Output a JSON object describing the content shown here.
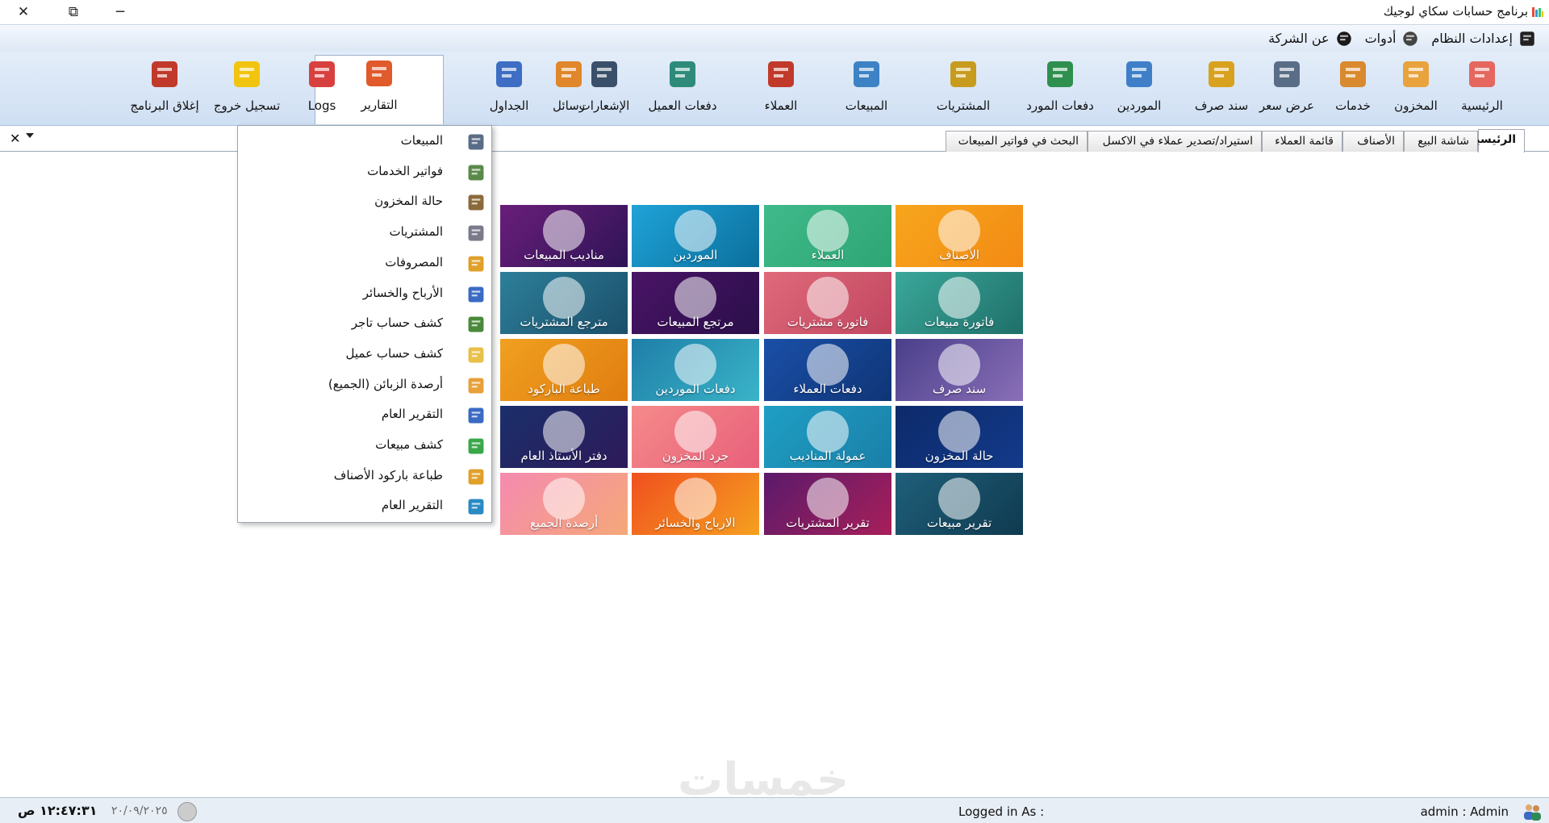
{
  "window": {
    "title": "برنامج حسابات سكاي لوجيك",
    "close_glyph": "✕",
    "restore_glyph": "⧉",
    "minimize_glyph": "─"
  },
  "menubar": {
    "items": [
      {
        "label": "إعدادات النظام",
        "icon": "wallet-icon"
      },
      {
        "label": "أدوات",
        "icon": "gear-icon"
      },
      {
        "label": "عن الشركة",
        "icon": "info-icon"
      }
    ]
  },
  "toolbar": {
    "buttons": [
      {
        "label": "الرئيسية",
        "icon": "home-icon",
        "color": "#e5675e"
      },
      {
        "label": "المخزون",
        "icon": "inventory-icon",
        "color": "#e8a33d"
      },
      {
        "label": "خدمات",
        "icon": "services-icon",
        "color": "#d9892e"
      },
      {
        "label": "عرض سعر",
        "icon": "quote-icon",
        "color": "#5a6d86"
      },
      {
        "label": "سند صرف",
        "icon": "voucher-icon",
        "color": "#d8a21f"
      },
      {
        "label": "الموردين",
        "icon": "suppliers-icon",
        "color": "#3f7fc8"
      },
      {
        "label": "دفعات المورد",
        "icon": "supplier-payments-icon",
        "color": "#2f8f4e"
      },
      {
        "label": "المشتريات",
        "icon": "purchases-icon",
        "color": "#c79c1e"
      },
      {
        "label": "المبيعات",
        "icon": "sales-icon",
        "color": "#3d82c4"
      },
      {
        "label": "العملاء",
        "icon": "customers-icon",
        "color": "#c0392b"
      },
      {
        "label": "دفعات العميل",
        "icon": "customer-payments-icon",
        "color": "#2e8b7a"
      },
      {
        "label": "الإشعارات",
        "icon": "notifications-icon",
        "color": "#3a4f6a"
      },
      {
        "label": "رسائل",
        "icon": "sms-icon",
        "color": "#e0862b"
      },
      {
        "label": "الجداول",
        "icon": "tables-icon",
        "color": "#3d6ec4"
      },
      {
        "label": "التقارير",
        "icon": "reports-icon",
        "color": "#e05a2b"
      },
      {
        "label": "Logs",
        "icon": "logs-icon",
        "color": "#d84040"
      },
      {
        "label": "تسجيل خروج",
        "icon": "lock-icon",
        "color": "#f1c40f"
      },
      {
        "label": "إغلاق البرنامج",
        "icon": "exit-icon",
        "color": "#c0392b"
      }
    ]
  },
  "tabs": [
    {
      "label": "الرئيسية",
      "active": true
    },
    {
      "label": "شاشة البيع",
      "active": false
    },
    {
      "label": "الأصناف",
      "active": false
    },
    {
      "label": "قائمة العملاء",
      "active": false
    },
    {
      "label": "استيراد/تصدير عملاء في الاكسل",
      "active": false
    },
    {
      "label": "البحث في فواتير المبيعات",
      "active": false
    }
  ],
  "tab_controls": {
    "close_glyph": "✕"
  },
  "tiles": [
    {
      "label": "الأصناف",
      "color_from": "#f7a61d",
      "color_to": "#f38a14"
    },
    {
      "label": "العملاء",
      "color_from": "#3fba8a",
      "color_to": "#2fa574"
    },
    {
      "label": "الموردين",
      "color_from": "#1fa3d8",
      "color_to": "#0b6f9c"
    },
    {
      "label": "مناديب المبيعات",
      "color_from": "#6a1e7a",
      "color_to": "#2e1456"
    },
    {
      "label": "فاتورة مبيعات",
      "color_from": "#3aa89a",
      "color_to": "#1f6f6a"
    },
    {
      "label": "فاتورة مشتريات",
      "color_from": "#e06a7a",
      "color_to": "#c04660"
    },
    {
      "label": "مرتجع المبيعات",
      "color_from": "#4a1466",
      "color_to": "#2a0f4a"
    },
    {
      "label": "مترجع المشتريات",
      "color_from": "#2d7f9a",
      "color_to": "#1b4f6a"
    },
    {
      "label": "سند صرف",
      "color_from": "#4a3f8a",
      "color_to": "#8a6fb8"
    },
    {
      "label": "دفعات العملاء",
      "color_from": "#1a4fa8",
      "color_to": "#0f3576"
    },
    {
      "label": "دفعات الموردين",
      "color_from": "#1f7fa8",
      "color_to": "#3ab4c8"
    },
    {
      "label": "طباعة الباركود",
      "color_from": "#f0a020",
      "color_to": "#e07d10"
    },
    {
      "label": "حالة المخزون",
      "color_from": "#0d2a6a",
      "color_to": "#133a8a"
    },
    {
      "label": "عمولة المناديب",
      "color_from": "#1f9fc4",
      "color_to": "#1a7fa8"
    },
    {
      "label": "جرد المخزون",
      "color_from": "#f58a8a",
      "color_to": "#e8607a"
    },
    {
      "label": "دفتر الأستاذ العام",
      "color_from": "#1a2f6a",
      "color_to": "#2e1a5a"
    },
    {
      "label": "تقرير مبيعات",
      "color_from": "#1f5f7a",
      "color_to": "#0f3a4f"
    },
    {
      "label": "تقرير المشتريات",
      "color_from": "#5a1a6a",
      "color_to": "#a81f5a"
    },
    {
      "label": "الارباح والخسائر",
      "color_from": "#f0501f",
      "color_to": "#f5a01f"
    },
    {
      "label": "أرصدة الجميع",
      "color_from": "#f58ab0",
      "color_to": "#f5a878"
    }
  ],
  "dropdown": {
    "items": [
      {
        "label": "المبيعات",
        "icon": "cart-icon",
        "color": "#5a6d86"
      },
      {
        "label": "فواتير الخدمات",
        "icon": "invoice-list-icon",
        "color": "#5a8a4a"
      },
      {
        "label": "حالة المخزون",
        "icon": "stock-status-icon",
        "color": "#8a6a3a"
      },
      {
        "label": "المشتريات",
        "icon": "purchases-report-icon",
        "color": "#7a7a8a"
      },
      {
        "label": "المصروفات",
        "icon": "expenses-icon",
        "color": "#e0a02b"
      },
      {
        "label": "الأرباح والخسائر",
        "icon": "profit-loss-icon",
        "color": "#3a6ac4"
      },
      {
        "label": "كشف حساب تاجر",
        "icon": "merchant-statement-icon",
        "color": "#4a8a3a"
      },
      {
        "label": "كشف حساب عميل",
        "icon": "customer-statement-icon",
        "color": "#e8c04a"
      },
      {
        "label": "أرصدة الزبائن (الجميع)",
        "icon": "balances-icon",
        "color": "#e8a03a"
      },
      {
        "label": "التقرير العام",
        "icon": "general-report-icon",
        "color": "#3a6ac4"
      },
      {
        "label": "كشف مبيعات",
        "icon": "sales-statement-icon",
        "color": "#3aa84a"
      },
      {
        "label": "طباعة باركود الأصناف",
        "icon": "barcode-icon",
        "color": "#e0a02b"
      },
      {
        "label": "التقرير العام",
        "icon": "summary-report-icon",
        "color": "#2a8ac4"
      }
    ]
  },
  "watermark": "خمسات",
  "status": {
    "time": "١٢:٤٧:٣١ ص",
    "date": "٢٠/٠٩/٢٠٢٥",
    "logged_in_label": "Logged in As :",
    "user": "admin  :  Admin"
  }
}
